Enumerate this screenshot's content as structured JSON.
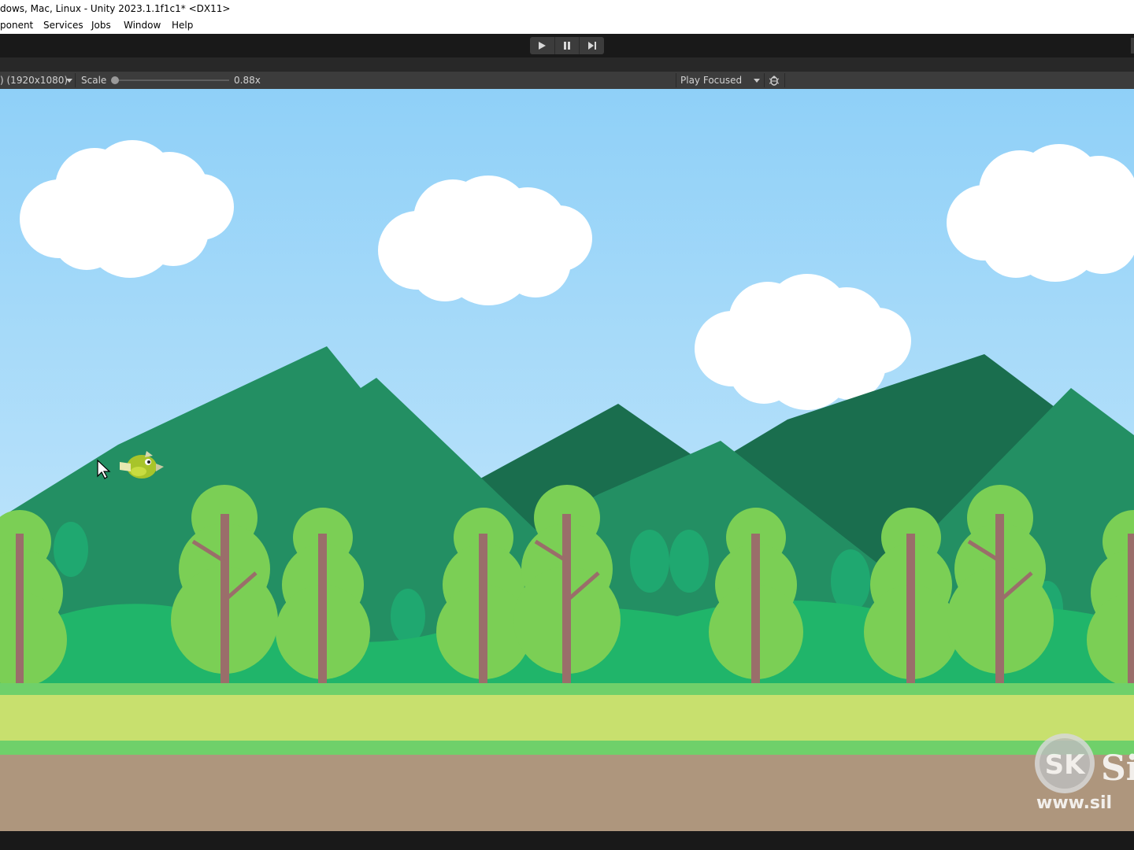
{
  "window": {
    "title": "dows, Mac, Linux - Unity 2023.1.1f1c1* <DX11>"
  },
  "menu": [
    "ponent",
    "Services",
    "Jobs",
    "Window",
    "Help"
  ],
  "toolbar": {
    "play_icon": "play-icon",
    "pause_icon": "pause-icon",
    "step_icon": "step-icon"
  },
  "game_view": {
    "resolution": ") (1920x1080)",
    "scale_label": "Scale",
    "scale_value": "0.88x",
    "play_mode": "Play Focused",
    "bug_icon": "bug-icon"
  },
  "scene": {
    "watermark_line2": "www.sil",
    "watermark_badge": "SK",
    "watermark_suffix": "Si",
    "colors": {
      "sky_top": "#8fd0f8",
      "sky_bottom": "#c8e8f8",
      "mountain_front": "#238f63",
      "mountain_back": "#1a6e4e",
      "tree_canopy": "#7bcf55",
      "tree_trunk": "#9a6e6a",
      "bush": "#20b56a",
      "grass_top": "#c8e06e",
      "grass_band": "#6fd06a",
      "dirt": "#ae967d"
    }
  }
}
